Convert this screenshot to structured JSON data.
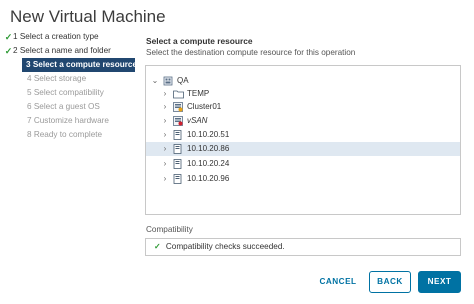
{
  "dialog": {
    "title": "New Virtual Machine"
  },
  "steps": [
    {
      "num": "1",
      "label": "Select a creation type",
      "state": "done"
    },
    {
      "num": "2",
      "label": "Select a name and folder",
      "state": "done"
    },
    {
      "num": "3",
      "label": "Select a compute resource",
      "state": "active"
    },
    {
      "num": "4",
      "label": "Select storage",
      "state": "pending"
    },
    {
      "num": "5",
      "label": "Select compatibility",
      "state": "pending"
    },
    {
      "num": "6",
      "label": "Select a guest OS",
      "state": "pending"
    },
    {
      "num": "7",
      "label": "Customize hardware",
      "state": "pending"
    },
    {
      "num": "8",
      "label": "Ready to complete",
      "state": "pending"
    }
  ],
  "main": {
    "title": "Select a compute resource",
    "subtitle": "Select the destination compute resource for this operation"
  },
  "tree": [
    {
      "label": "QA",
      "icon": "datacenter-icon",
      "expanded": true,
      "level": 0,
      "italic": false,
      "selected": false
    },
    {
      "label": "TEMP",
      "icon": "folder-icon",
      "expanded": false,
      "level": 1,
      "italic": false,
      "selected": false
    },
    {
      "label": "Cluster01",
      "icon": "cluster-icon",
      "expanded": false,
      "level": 1,
      "italic": false,
      "selected": false
    },
    {
      "label": "vSAN",
      "icon": "vsan-cluster-icon",
      "expanded": false,
      "level": 1,
      "italic": true,
      "selected": false
    },
    {
      "label": "10.10.20.51",
      "icon": "host-icon",
      "expanded": false,
      "level": 1,
      "italic": false,
      "selected": false
    },
    {
      "label": "10.10.20.86",
      "icon": "host-icon",
      "expanded": false,
      "level": 1,
      "italic": false,
      "selected": true
    },
    {
      "label": "10.10.20.24",
      "icon": "host-icon",
      "expanded": false,
      "level": 1,
      "italic": false,
      "selected": false
    },
    {
      "label": "10.10.20.96",
      "icon": "host-icon",
      "expanded": false,
      "level": 1,
      "italic": false,
      "selected": false
    }
  ],
  "compatibility": {
    "label": "Compatibility",
    "message": "Compatibility checks succeeded."
  },
  "buttons": {
    "cancel": "CANCEL",
    "back": "BACK",
    "next": "NEXT"
  },
  "colors": {
    "accent": "#0072a3",
    "active_step": "#214770",
    "success": "#2d9a34",
    "selected_row": "#dfe8f1"
  }
}
